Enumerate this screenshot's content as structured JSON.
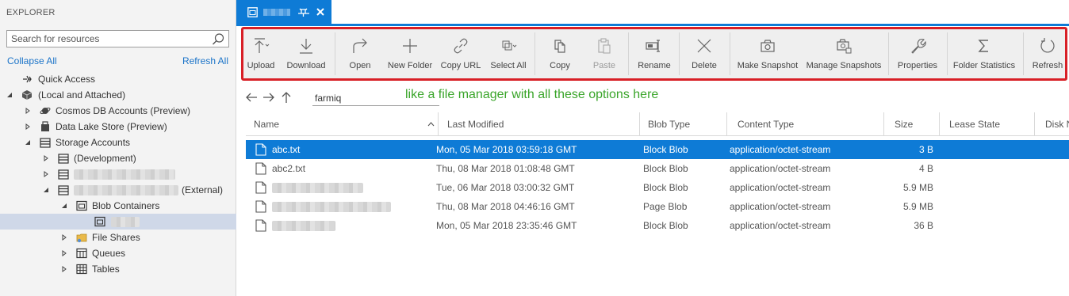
{
  "sidebar": {
    "header": "EXPLORER",
    "search_placeholder": "Search for resources",
    "collapse_all": "Collapse All",
    "refresh_all": "Refresh All",
    "tree": {
      "quick_access": "Quick Access",
      "local_attached": "(Local and Attached)",
      "cosmos": "Cosmos DB Accounts (Preview)",
      "datalake": "Data Lake Store (Preview)",
      "storage_accounts": "Storage Accounts",
      "development": "(Development)",
      "external": "(External)",
      "blob_containers": "Blob Containers",
      "file_shares": "File Shares",
      "queues": "Queues",
      "tables": "Tables"
    }
  },
  "colors": {
    "accent": "#0e7bd6",
    "highlight_box": "#d81f26",
    "annotation": "#3aa52a",
    "link": "#1a73c8"
  },
  "toolbar": {
    "upload": "Upload",
    "download": "Download",
    "open": "Open",
    "new_folder": "New Folder",
    "copy_url": "Copy URL",
    "select_all": "Select All",
    "copy": "Copy",
    "paste": "Paste",
    "rename": "Rename",
    "delete": "Delete",
    "make_snapshot": "Make Snapshot",
    "manage_snapshots": "Manage Snapshots",
    "properties": "Properties",
    "folder_statistics": "Folder Statistics",
    "refresh": "Refresh"
  },
  "navbar": {
    "path": "farmiq"
  },
  "annotation": "like a file manager with all these options here",
  "table": {
    "columns": {
      "name": "Name",
      "last_modified": "Last Modified",
      "blob_type": "Blob Type",
      "content_type": "Content Type",
      "size": "Size",
      "lease_state": "Lease State",
      "disk": "Disk N"
    },
    "rows": [
      {
        "name": "abc.txt",
        "modified": "Mon, 05 Mar 2018 03:59:18 GMT",
        "blob_type": "Block Blob",
        "content_type": "application/octet-stream",
        "size": "3 B"
      },
      {
        "name": "abc2.txt",
        "modified": "Thu, 08 Mar 2018 01:08:48 GMT",
        "blob_type": "Block Blob",
        "content_type": "application/octet-stream",
        "size": "4 B"
      },
      {
        "name": "",
        "modified": "Tue, 06 Mar 2018 03:00:32 GMT",
        "blob_type": "Block Blob",
        "content_type": "application/octet-stream",
        "size": "5.9 MB"
      },
      {
        "name": "",
        "modified": "Thu, 08 Mar 2018 04:46:16 GMT",
        "blob_type": "Page Blob",
        "content_type": "application/octet-stream",
        "size": "5.9 MB"
      },
      {
        "name": "",
        "modified": "Mon, 05 Mar 2018 23:35:46 GMT",
        "blob_type": "Block Blob",
        "content_type": "application/octet-stream",
        "size": "36 B"
      }
    ]
  }
}
